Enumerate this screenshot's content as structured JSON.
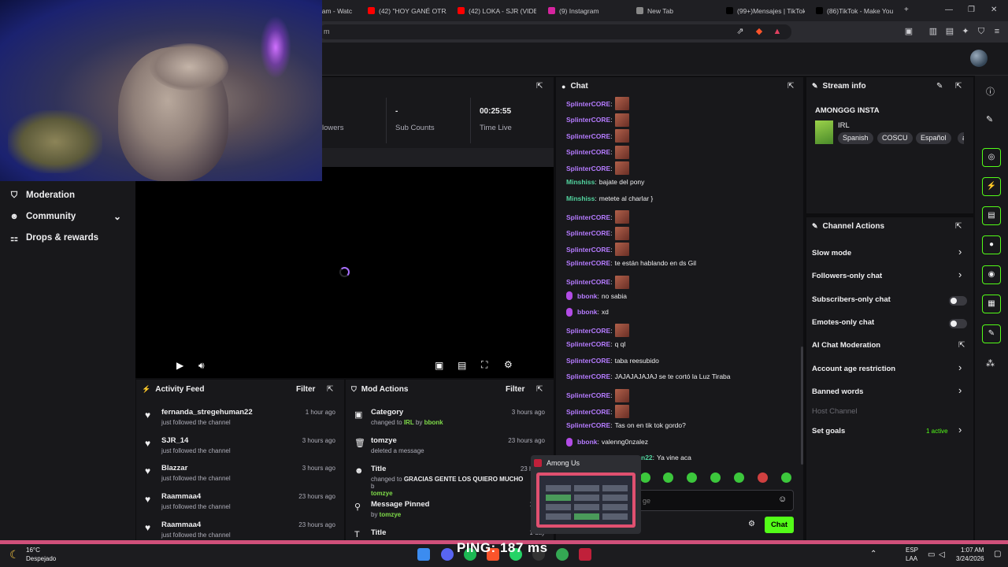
{
  "browser": {
    "tabs": [
      {
        "label": "eam - Watc",
        "color": "#2a2a2e"
      },
      {
        "label": "(42) \"HOY GANÉ OTRA",
        "color": "#ff0000"
      },
      {
        "label": "(42) LOKA - SJR (VIDEO",
        "color": "#ff0000"
      },
      {
        "label": "(9) Instagram",
        "color": "#d6249f"
      },
      {
        "label": "New Tab",
        "color": "#888888"
      },
      {
        "label": "(99+)Mensajes | TikTok",
        "color": "#000000"
      },
      {
        "label": "(86)TikTok - Make You",
        "color": "#000000"
      }
    ],
    "new_tab": "+",
    "url": "m",
    "window_controls": [
      "—",
      "❐",
      "✕"
    ]
  },
  "leftnav": {
    "items": [
      {
        "label": "Moderation",
        "icon": "shield-icon"
      },
      {
        "label": "Community",
        "icon": "people-icon"
      },
      {
        "label": "Drops & rewards",
        "icon": "gift-icon"
      }
    ]
  },
  "stats": {
    "followers_label": "lowers",
    "sub_value": "-",
    "sub_label": "Sub Counts",
    "time_value": "00:25:55",
    "time_label": "Time Live"
  },
  "activity_feed": {
    "title": "Activity Feed",
    "filter": "Filter",
    "items": [
      {
        "name": "fernanda_stregehuman22",
        "sub": "just followed the channel",
        "time": "1 hour ago"
      },
      {
        "name": "SJR_14",
        "sub": "just followed the channel",
        "time": "3 hours ago"
      },
      {
        "name": "Blazzar",
        "sub": "just followed the channel",
        "time": "3 hours ago"
      },
      {
        "name": "Raammaa4",
        "sub": "just followed the channel",
        "time": "23 hours ago"
      },
      {
        "name": "Raammaa4",
        "sub": "just followed the channel",
        "time": "23 hours ago"
      }
    ]
  },
  "mod_actions": {
    "title": "Mod Actions",
    "filter": "Filter",
    "items": [
      {
        "name": "Category",
        "pre": "changed to ",
        "hl1": "IRL",
        "mid": " by ",
        "hl2": "bbonk",
        "time": "3 hours ago"
      },
      {
        "name": "tomzye",
        "pre": "deleted a message",
        "hl1": "",
        "mid": "",
        "hl2": "",
        "time": "23 hours ago"
      },
      {
        "name": "Title",
        "pre": "changed to ",
        "hl1": "GRACIAS GENTE LOS QUIERO MUCHO",
        "mid": " b",
        "hl2": "tomzye",
        "time": "23 hours"
      },
      {
        "name": "Message Pinned",
        "pre": "by ",
        "hl1": "tomzye",
        "mid": "",
        "hl2": "",
        "time": "1 day"
      },
      {
        "name": "Title",
        "pre": "",
        "hl1": "",
        "mid": "",
        "hl2": "",
        "time": "1 day"
      }
    ]
  },
  "chat": {
    "title": "Chat",
    "messages": [
      {
        "user": "SplinterCORE",
        "sep": ":",
        "text": "",
        "emote": true,
        "color": "purple",
        "badge": false
      },
      {
        "user": "SplinterCORE",
        "sep": ":",
        "text": "",
        "emote": true,
        "color": "purple",
        "badge": false
      },
      {
        "user": "SplinterCORE",
        "sep": ":",
        "text": "",
        "emote": true,
        "color": "purple",
        "badge": false
      },
      {
        "user": "SplinterCORE",
        "sep": ":",
        "text": "",
        "emote": true,
        "color": "purple",
        "badge": false
      },
      {
        "user": "SplinterCORE",
        "sep": ":",
        "text": "",
        "emote": true,
        "color": "purple",
        "badge": false
      },
      {
        "user": "Minshiss",
        "sep": ":",
        "text": "bajate del pony",
        "emote": false,
        "color": "green",
        "badge": false
      },
      {
        "user": "Minshiss",
        "sep": ":",
        "text": "metete al charlar }",
        "emote": false,
        "color": "green",
        "badge": false
      },
      {
        "user": "SplinterCORE",
        "sep": ":",
        "text": "",
        "emote": true,
        "color": "purple",
        "badge": false
      },
      {
        "user": "SplinterCORE",
        "sep": ":",
        "text": "",
        "emote": true,
        "color": "purple",
        "badge": false
      },
      {
        "user": "SplinterCORE",
        "sep": ":",
        "text": "",
        "emote": true,
        "color": "purple",
        "badge": false
      },
      {
        "user": "SplinterCORE",
        "sep": ":",
        "text": "te están hablando en ds Gil",
        "emote": false,
        "color": "purple",
        "badge": false
      },
      {
        "user": "SplinterCORE",
        "sep": ":",
        "text": "",
        "emote": true,
        "color": "purple",
        "badge": false
      },
      {
        "user": "bbonk",
        "sep": ":",
        "text": "no sabia",
        "emote": false,
        "color": "purple",
        "badge": true
      },
      {
        "user": "bbonk",
        "sep": ":",
        "text": "xd",
        "emote": false,
        "color": "purple",
        "badge": true
      },
      {
        "user": "SplinterCORE",
        "sep": ":",
        "text": "",
        "emote": true,
        "color": "purple",
        "badge": false
      },
      {
        "user": "SplinterCORE",
        "sep": ":",
        "text": "q ql",
        "emote": false,
        "color": "purple",
        "badge": false
      },
      {
        "user": "SplinterCORE",
        "sep": ":",
        "text": "taba reesubido",
        "emote": false,
        "color": "purple",
        "badge": false
      },
      {
        "user": "SplinterCORE",
        "sep": ":",
        "text": "JAJAJAJAJAJ se te cortó la Luz Tiraba",
        "emote": false,
        "color": "purple",
        "badge": false
      },
      {
        "user": "SplinterCORE",
        "sep": ":",
        "text": "",
        "emote": true,
        "color": "purple",
        "badge": false
      },
      {
        "user": "SplinterCORE",
        "sep": ":",
        "text": "",
        "emote": true,
        "color": "purple",
        "badge": false
      },
      {
        "user": "SplinterCORE",
        "sep": ":",
        "text": "Tas on en tik tok gordo?",
        "emote": false,
        "color": "purple",
        "badge": false
      },
      {
        "user": "bbonk",
        "sep": ":",
        "text": "valenng0nzalez",
        "emote": false,
        "color": "purple",
        "badge": true
      },
      {
        "user": "n22",
        "sep": ":",
        "text": "Ya vine aca",
        "emote": false,
        "color": "green",
        "badge": false
      }
    ],
    "input_placeholder": "ge",
    "send_label": "Chat"
  },
  "stream_info": {
    "title": "Stream info",
    "stream_title": "AMONGGG INSTA",
    "category": "IRL",
    "tags": [
      "Spanish",
      "COSCU",
      "Español",
      "a"
    ]
  },
  "channel_actions": {
    "title": "Channel Actions",
    "items": [
      {
        "label": "Slow mode",
        "kind": "chevron"
      },
      {
        "label": "Followers-only chat",
        "kind": "chevron"
      },
      {
        "label": "Subscribers-only chat",
        "kind": "toggle"
      },
      {
        "label": "Emotes-only chat",
        "kind": "toggle"
      },
      {
        "label": "AI Chat Moderation",
        "kind": "popout"
      },
      {
        "label": "Account age restriction",
        "kind": "chevron"
      },
      {
        "label": "Banned words",
        "kind": "chevron"
      },
      {
        "label": "Host Channel",
        "kind": "disabled"
      },
      {
        "label": "Set goals",
        "kind": "chevron"
      }
    ],
    "goals_status": "1 active"
  },
  "popup": {
    "title": "Among Us"
  },
  "taskbar": {
    "overlay_text": "PING: 187 ms",
    "temperature": "16°C",
    "weather": "Despejado",
    "lang_top": "ESP",
    "lang_bottom": "LAA",
    "time": "1:07 AM",
    "date": "3/24/2026"
  },
  "colors": {
    "accent": "#53fc18",
    "purple_user": "#b57bff",
    "green_user": "#52d49f"
  }
}
